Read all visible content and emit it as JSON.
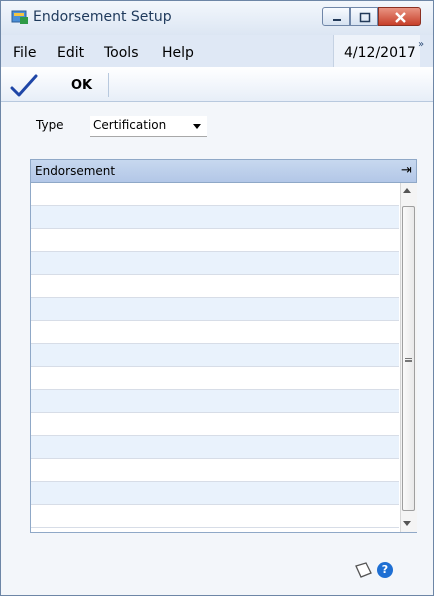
{
  "window": {
    "title": "Endorsement Setup"
  },
  "menu": {
    "items": [
      "File",
      "Edit",
      "Tools",
      "Help"
    ],
    "date": "4/12/2017"
  },
  "toolbar": {
    "ok_label": "OK"
  },
  "form": {
    "type_label": "Type",
    "type_value": "Certification"
  },
  "grid": {
    "header": "Endorsement",
    "row_count": 15
  },
  "icons": [
    "window-icon",
    "minimize-icon",
    "maximize-icon",
    "close-icon",
    "ok-check-icon",
    "dropdown-arrow-icon",
    "expand-columns-icon",
    "scroll-up-icon",
    "scroll-down-icon",
    "note-icon",
    "help-icon"
  ],
  "colors": {
    "title_text": "#1e395b",
    "header_bg": "#b3c7e7",
    "alt_row": "#e9f2fc",
    "help_blue": "#1e6fd3"
  }
}
